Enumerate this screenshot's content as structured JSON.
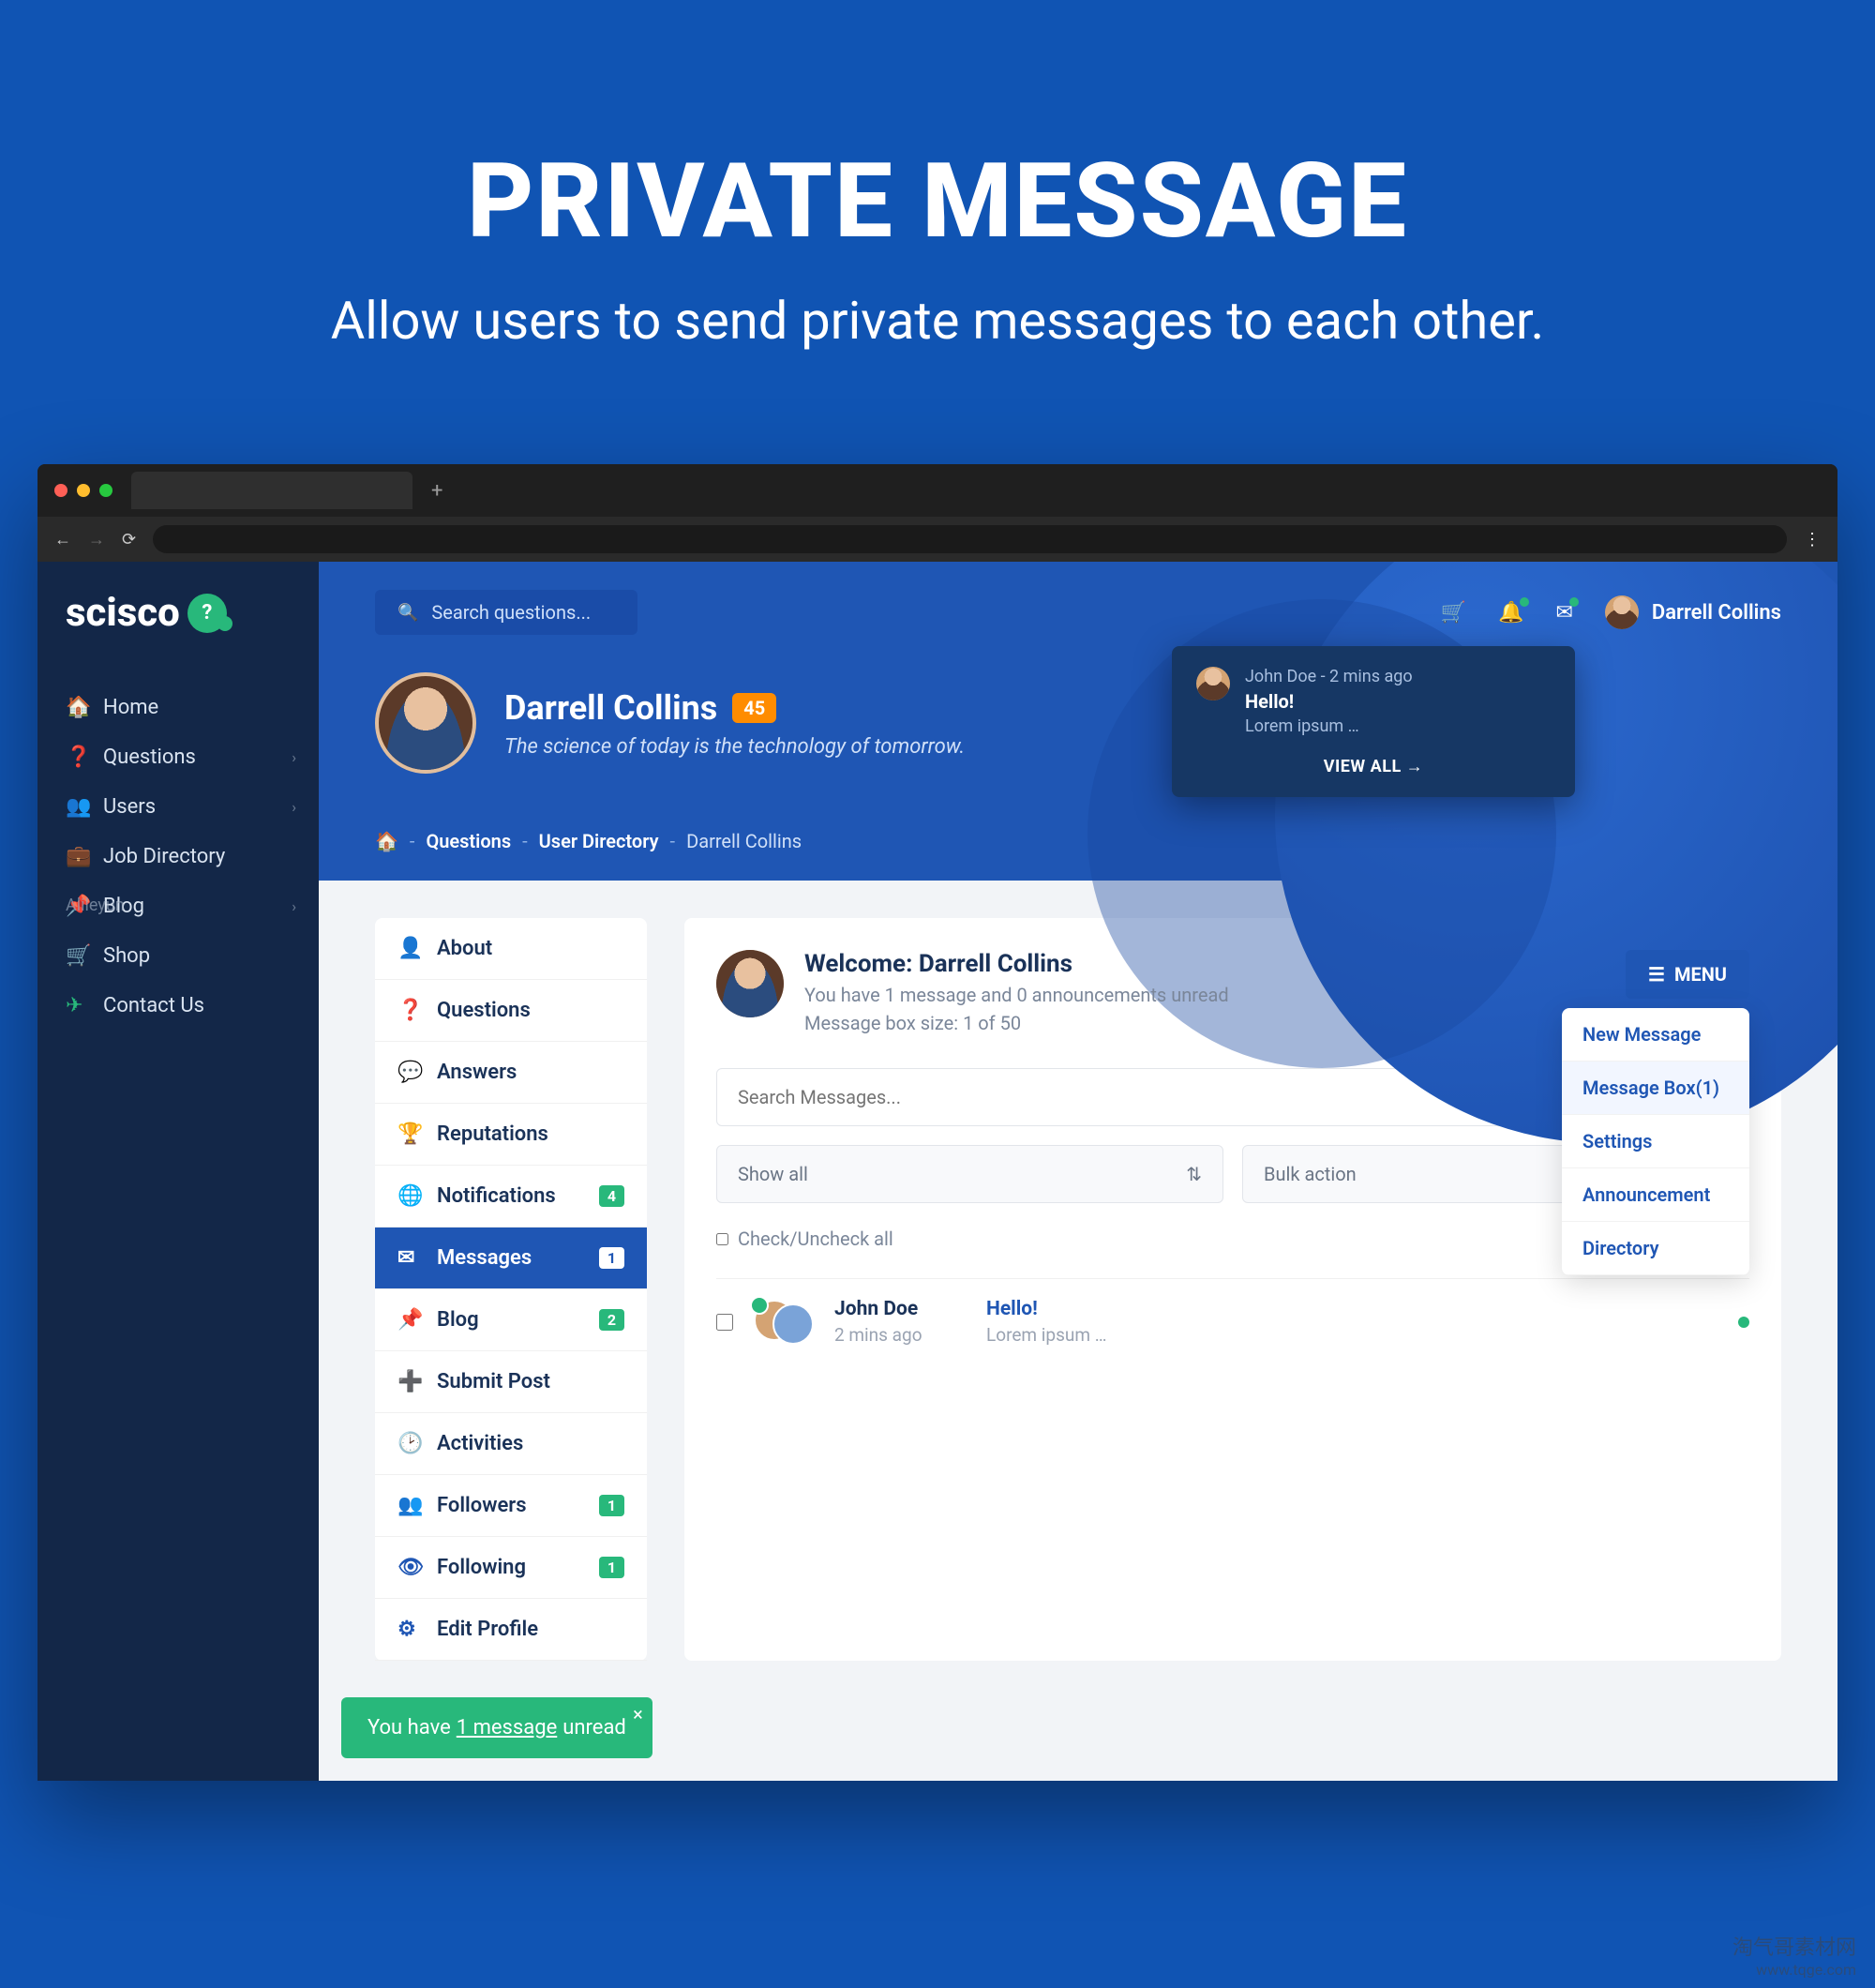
{
  "hero": {
    "title": "PRIVATE MESSAGE",
    "subtitle": "Allow users to send private messages to each other."
  },
  "logo": "scisco",
  "sidebar": {
    "items": [
      {
        "label": "Home",
        "icon": "home"
      },
      {
        "label": "Questions",
        "icon": "help",
        "chev": true
      },
      {
        "label": "Users",
        "icon": "users",
        "chev": true
      },
      {
        "label": "Job Directory",
        "icon": "briefcase"
      },
      {
        "label": "Blog",
        "icon": "pin",
        "chev": true
      },
      {
        "label": "Shop",
        "icon": "cart"
      },
      {
        "label": "Contact Us",
        "icon": "send"
      }
    ]
  },
  "search": {
    "placeholder": "Search questions..."
  },
  "user": {
    "name": "Darrell Collins"
  },
  "notification_popup": {
    "meta": "John Doe - 2 mins ago",
    "title": "Hello!",
    "body": "Lorem ipsum …",
    "footer": "VIEW ALL"
  },
  "profile": {
    "name": "Darrell Collins",
    "badge": "45",
    "tagline": "The science of today is the technology of tomorrow."
  },
  "breadcrumb": {
    "items": [
      "Questions",
      "User Directory"
    ],
    "current": "Darrell Collins"
  },
  "profile_menu": {
    "items": [
      {
        "label": "About",
        "icon": "user"
      },
      {
        "label": "Questions",
        "icon": "help"
      },
      {
        "label": "Answers",
        "icon": "comment"
      },
      {
        "label": "Reputations",
        "icon": "trophy"
      },
      {
        "label": "Notifications",
        "icon": "globe",
        "pill": "4"
      },
      {
        "label": "Messages",
        "icon": "mail",
        "pill": "1",
        "active": true
      },
      {
        "label": "Blog",
        "icon": "pin",
        "pill": "2"
      },
      {
        "label": "Submit Post",
        "icon": "plus"
      },
      {
        "label": "Activities",
        "icon": "history"
      },
      {
        "label": "Followers",
        "icon": "followers",
        "pill": "1"
      },
      {
        "label": "Following",
        "icon": "eye",
        "pill": "1"
      },
      {
        "label": "Edit Profile",
        "icon": "gear"
      }
    ]
  },
  "messages": {
    "welcome": "Welcome: Darrell Collins",
    "sub1": "You have 1 message and 0 announcements unread",
    "sub2": "Message box size: 1 of 50",
    "menu_button": "MENU",
    "dropdown": [
      {
        "label": "New Message"
      },
      {
        "label": "Message Box",
        "count": "(1)",
        "sel": true
      },
      {
        "label": "Settings"
      },
      {
        "label": "Announcement"
      },
      {
        "label": "Directory"
      }
    ],
    "search_placeholder": "Search Messages...",
    "filter1": "Show all",
    "filter2": "Bulk action",
    "check_all": "Check/Uncheck all",
    "rows": [
      {
        "name": "John Doe",
        "time": "2 mins ago",
        "subject": "Hello!",
        "excerpt": "Lorem ipsum …"
      }
    ]
  },
  "toast": {
    "pre": "You have ",
    "link": "1 message",
    "post": " unread"
  },
  "watermarks": {
    "mid": "Alileyun",
    "br_top": "淘气哥素材网",
    "br_sub": "www.tqge.com"
  }
}
